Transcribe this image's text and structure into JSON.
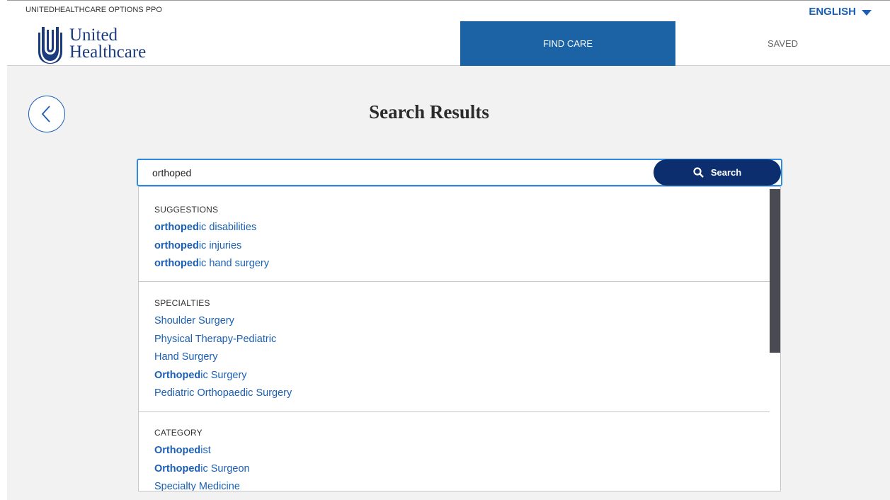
{
  "topbar": {
    "plan_name": "UNITEDHEALTHCARE OPTIONS PPO",
    "language": "ENGLISH"
  },
  "logo": {
    "line1": "United",
    "line2": "Healthcare"
  },
  "nav": {
    "find_care": "FIND CARE",
    "saved": "SAVED"
  },
  "page_title": "Search Results",
  "search": {
    "value": "orthoped",
    "button_label": "Search"
  },
  "sections": {
    "suggestions": {
      "title": "SUGGESTIONS",
      "items": [
        {
          "match": "orthoped",
          "rest": "ic disabilities"
        },
        {
          "match": "orthoped",
          "rest": "ic injuries"
        },
        {
          "match": "orthoped",
          "rest": "ic hand surgery"
        }
      ]
    },
    "specialties": {
      "title": "SPECIALTIES",
      "items": [
        {
          "match": "",
          "rest": "Shoulder Surgery"
        },
        {
          "match": "",
          "rest": "Physical Therapy-Pediatric"
        },
        {
          "match": "",
          "rest": "Hand Surgery"
        },
        {
          "match": "Orthoped",
          "rest": "ic Surgery"
        },
        {
          "match": "",
          "rest": "Pediatric Orthopaedic Surgery"
        }
      ]
    },
    "category": {
      "title": "CATEGORY",
      "items": [
        {
          "match": "Orthoped",
          "rest": "ist"
        },
        {
          "match": "Orthoped",
          "rest": "ic Surgeon"
        },
        {
          "match": "",
          "rest": "Specialty Medicine"
        }
      ]
    }
  },
  "colors": {
    "accent": "#1a5fb4",
    "nav_active": "#1b63a5",
    "search_button": "#0d2e6e",
    "logo": "#1b3b7e"
  },
  "icons": {
    "back": "chevron-left-icon",
    "search": "search-icon",
    "language_caret": "caret-down-icon",
    "logo": "uhc-logo-icon"
  }
}
